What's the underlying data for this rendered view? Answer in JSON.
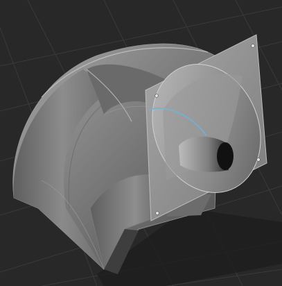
{
  "viewport": {
    "background": "#282828",
    "grid_color": "#3a3a3a",
    "selection_accent": "#6fb3d9"
  },
  "model": {
    "body_color": "#8a8a8a",
    "shadow_color": "#4a4a4a",
    "highlight_color": "#c9c9c9",
    "flange_color": "#9a9a9a"
  },
  "icons": [
    "screw-icon"
  ]
}
